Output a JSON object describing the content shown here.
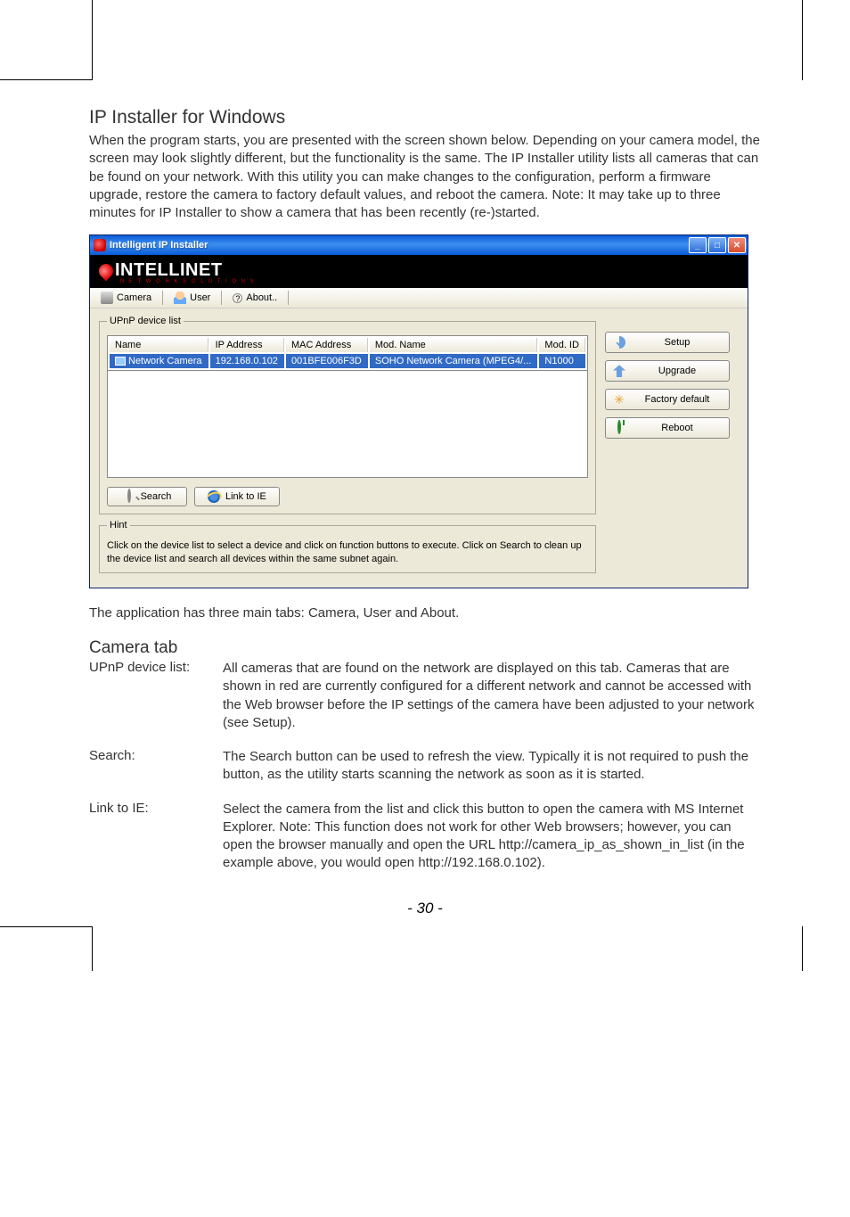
{
  "page": {
    "number": "- 30 -"
  },
  "heading": "IP Installer for Windows",
  "intro": "When the program starts, you are presented with the screen shown below. Depending on your camera model, the screen may look slightly different, but the functionality is the same. The IP Installer utility lists all cameras that can be found on your network. With this utility you can make changes to the configuration, perform a firmware upgrade, restore the camera to factory default values, and reboot the camera. Note: It may take up to three minutes for IP Installer to show a camera that has been recently (re-)started.",
  "tabs_line": "The application has three main tabs: Camera, User and About.",
  "camera_tab_heading": "Camera tab",
  "defs": {
    "upnp_label": "UPnP device list:",
    "upnp_text": "All cameras that are found on the network are displayed on this tab. Cameras that are shown in red are currently configured for a different network and cannot be accessed with the Web browser before the IP settings of the camera have been adjusted to your network (see Setup).",
    "search_label": "Search:",
    "search_text": "The Search button can be used to refresh the view. Typically it is not required to push the button, as the utility starts scanning the network as soon as it is started.",
    "linkie_label": "Link to IE:",
    "linkie_text": "Select the camera from the list and click this button to open the camera with MS Internet Explorer. Note: This function does not work for other Web browsers; however, you can open the browser manually and open the URL http://camera_ip_as_shown_in_list (in the example above, you would open http://192.168.0.102)."
  },
  "app": {
    "title": "Intelligent IP Installer",
    "brand": "INTELLINET",
    "brand_sub": "N E T W O R K   S O L U T I O N S",
    "menu": {
      "camera": "Camera",
      "user": "User",
      "about": "About.."
    },
    "group_label": "UPnP device list",
    "columns": {
      "name": "Name",
      "ip": "IP Address",
      "mac": "MAC Address",
      "mod_name": "Mod. Name",
      "mod_id": "Mod. ID"
    },
    "row": {
      "name": "Network Camera",
      "ip": "192.168.0.102",
      "mac": "001BFE006F3D",
      "mod_name": "SOHO Network Camera (MPEG4/...",
      "mod_id": "N1000"
    },
    "buttons": {
      "search": "Search",
      "link_ie": "Link to IE",
      "setup": "Setup",
      "upgrade": "Upgrade",
      "factory": "Factory default",
      "reboot": "Reboot"
    },
    "hint_label": "Hint",
    "hint_text": "Click on the device list to select a device and click on function buttons to execute. Click on Search to clean up the device list and search all devices  within the same subnet again."
  }
}
